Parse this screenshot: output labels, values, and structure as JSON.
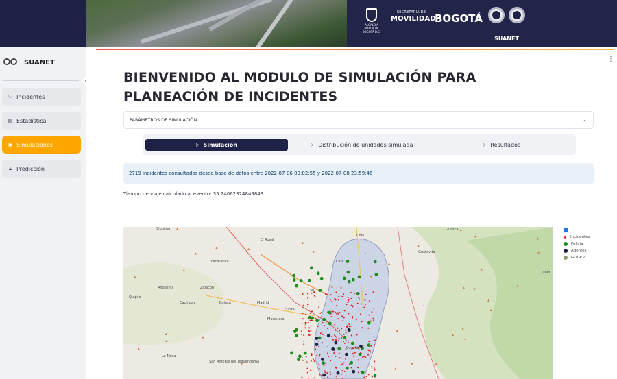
{
  "banner": {
    "alcaldia_text": "ALCALDÍA MAYOR DE BOGOTÁ D.C.",
    "secretaria_small": "SECRETARÍA DE",
    "secretaria_big": "MOVILIDAD",
    "bogota": "BOGOTÁ",
    "suanet": "SUANET"
  },
  "sidebar": {
    "title": "SUANET",
    "items": [
      {
        "label": "Incidentes",
        "icon": "shield-icon"
      },
      {
        "label": "Estadística",
        "icon": "chart-icon"
      },
      {
        "label": "Simulaciones",
        "icon": "simulation-icon",
        "active": true
      },
      {
        "label": "Predicción",
        "icon": "lock-icon"
      }
    ]
  },
  "main": {
    "title": "BIENVENIDO AL MODULO DE SIMULACIÓN PARA PLANEACIÓN DE INCIDENTES",
    "expander_label": "PARÁMETROS DE SIMULACIÓN",
    "tabs": [
      {
        "label": "Simulación",
        "active": true
      },
      {
        "label": "Distribución de unidades simulada"
      },
      {
        "label": "Resultados"
      }
    ],
    "info": "2719 incidentes consultados desde base de datos entre 2022-07-06 00:02:55 y 2022-07-08 23:59:46",
    "travel_time": "Tiempo de viaje calculado al evento: 35.24062324849843"
  },
  "map": {
    "places": [
      "Síquima",
      "El Rosal",
      "Chía",
      "Guasca",
      "Facatativá",
      "Cota",
      "Guatavita",
      "Zipacón",
      "Anolaima",
      "Cachipay",
      "Bojacá",
      "Madrid",
      "Mosquera",
      "Funza",
      "Quipile",
      "La Mesa",
      "San Antonio del Tequendama",
      "Bogotá",
      "Junín"
    ],
    "road_label": "50"
  },
  "legend": {
    "items": [
      {
        "label": "",
        "color": "#1f77e5"
      },
      {
        "label": "Incidentes",
        "color": "#e02020"
      },
      {
        "label": "Policia",
        "color": "#1f8c1f"
      },
      {
        "label": "Agentes",
        "color": "#1f2247"
      },
      {
        "label": "GOGEV",
        "color": "#8a9a6a"
      }
    ]
  },
  "colors": {
    "accent": "#ffa500",
    "navy": "#1f2247",
    "info_bg": "#e8f0f8"
  }
}
